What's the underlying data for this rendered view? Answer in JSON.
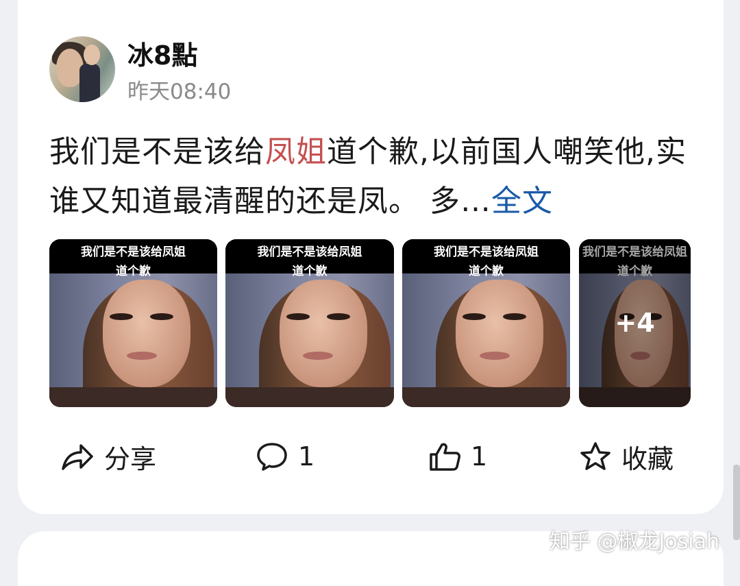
{
  "post": {
    "author": "冰8點",
    "time": "昨天08:40",
    "text_part1": "我们是不是该给",
    "text_highlight": "凤姐",
    "text_part2": "道个歉,以前国人嘲笑他,实谁又知道最清醒的还是凤。 多…",
    "more_link": "全文"
  },
  "images": {
    "caption_line1": "我们是不是该给凤姐",
    "caption_line2": "道个歉",
    "more_count": "+4"
  },
  "actions": {
    "share_label": "分享",
    "comment_count": "1",
    "like_count": "1",
    "favorite_label": "收藏"
  },
  "watermark": "知乎 @椒龙Josiah",
  "colors": {
    "highlight": "#c45050",
    "link": "#1a5aa8"
  }
}
